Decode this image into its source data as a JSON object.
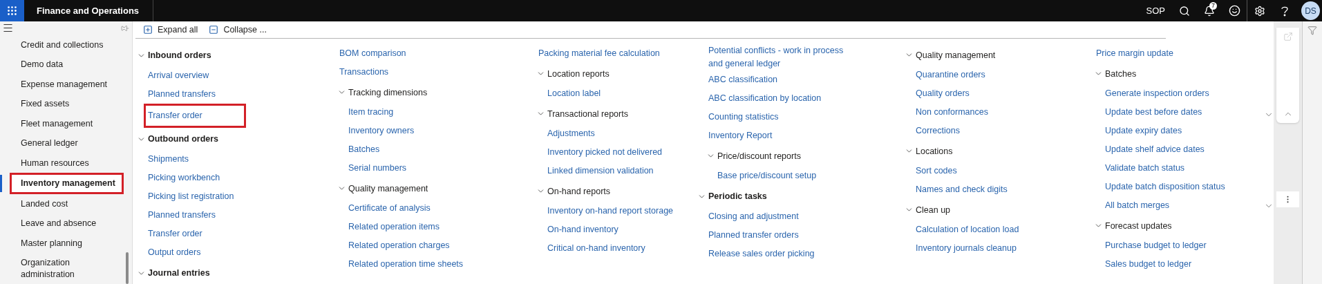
{
  "topbar": {
    "app_title": "Finance and Operations",
    "company": "SOP",
    "notification_count": "7",
    "avatar_initials": "DS"
  },
  "sidebar": {
    "items": [
      {
        "label": "Credit and collections",
        "selected": false,
        "highlighted": false
      },
      {
        "label": "Demo data",
        "selected": false,
        "highlighted": false
      },
      {
        "label": "Expense management",
        "selected": false,
        "highlighted": false
      },
      {
        "label": "Fixed assets",
        "selected": false,
        "highlighted": false
      },
      {
        "label": "Fleet management",
        "selected": false,
        "highlighted": false
      },
      {
        "label": "General ledger",
        "selected": false,
        "highlighted": false
      },
      {
        "label": "Human resources",
        "selected": false,
        "highlighted": false
      },
      {
        "label": "Inventory management",
        "selected": true,
        "highlighted": true
      },
      {
        "label": "Landed cost",
        "selected": false,
        "highlighted": false
      },
      {
        "label": "Leave and absence",
        "selected": false,
        "highlighted": false
      },
      {
        "label": "Master planning",
        "selected": false,
        "highlighted": false
      },
      {
        "label": "Organization administration",
        "selected": false,
        "highlighted": false
      }
    ]
  },
  "toolbar": {
    "expand_all": "Expand all",
    "collapse": "Collapse ..."
  },
  "menu_columns": [
    {
      "entries": [
        {
          "kind": "heading",
          "label": "Inbound orders",
          "expanded": true,
          "children": [
            {
              "kind": "link",
              "label": "Arrival overview",
              "highlighted": false
            },
            {
              "kind": "link",
              "label": "Planned transfers",
              "highlighted": false
            },
            {
              "kind": "link",
              "label": "Transfer order",
              "highlighted": true
            }
          ]
        },
        {
          "kind": "heading",
          "label": "Outbound orders",
          "expanded": true,
          "children": [
            {
              "kind": "link",
              "label": "Shipments",
              "highlighted": false
            },
            {
              "kind": "link",
              "label": "Picking workbench",
              "highlighted": false
            },
            {
              "kind": "link",
              "label": "Picking list registration",
              "highlighted": false
            },
            {
              "kind": "link",
              "label": "Planned transfers",
              "highlighted": false
            },
            {
              "kind": "link",
              "label": "Transfer order",
              "highlighted": false
            },
            {
              "kind": "link",
              "label": "Output orders",
              "highlighted": false
            }
          ]
        },
        {
          "kind": "heading",
          "label": "Journal entries",
          "expanded": true
        }
      ]
    },
    {
      "entries": [
        {
          "kind": "link",
          "label": "BOM comparison",
          "highlighted": false
        },
        {
          "kind": "link",
          "label": "Transactions",
          "highlighted": false
        },
        {
          "kind": "subheading",
          "label": "Tracking dimensions",
          "expanded": true,
          "children": [
            {
              "kind": "link",
              "label": "Item tracing",
              "highlighted": false
            },
            {
              "kind": "link",
              "label": "Inventory owners",
              "highlighted": false
            },
            {
              "kind": "link",
              "label": "Batches",
              "highlighted": false
            },
            {
              "kind": "link",
              "label": "Serial numbers",
              "highlighted": false
            }
          ]
        },
        {
          "kind": "subheading",
          "label": "Quality management",
          "expanded": true,
          "children": [
            {
              "kind": "link",
              "label": "Certificate of analysis",
              "highlighted": false
            },
            {
              "kind": "link",
              "label": "Related operation items",
              "highlighted": false
            },
            {
              "kind": "link",
              "label": "Related operation charges",
              "highlighted": false
            },
            {
              "kind": "link",
              "label": "Related operation time sheets",
              "highlighted": false
            }
          ]
        }
      ]
    },
    {
      "entries": [
        {
          "kind": "link",
          "label": "Packing material fee calculation",
          "highlighted": false
        },
        {
          "kind": "subheading",
          "label": "Location reports",
          "expanded": true,
          "children": [
            {
              "kind": "link",
              "label": "Location label",
              "highlighted": false
            }
          ]
        },
        {
          "kind": "subheading",
          "label": "Transactional reports",
          "expanded": true,
          "children": [
            {
              "kind": "link",
              "label": "Adjustments",
              "highlighted": false
            },
            {
              "kind": "link",
              "label": "Inventory picked not delivered",
              "highlighted": false
            },
            {
              "kind": "link",
              "label": "Linked dimension validation",
              "highlighted": false
            }
          ]
        },
        {
          "kind": "subheading",
          "label": "On-hand reports",
          "expanded": true,
          "children": [
            {
              "kind": "link",
              "label": "Inventory on-hand report storage",
              "highlighted": false
            },
            {
              "kind": "link",
              "label": "On-hand inventory",
              "highlighted": false
            },
            {
              "kind": "link",
              "label": "Critical on-hand inventory",
              "highlighted": false
            }
          ]
        }
      ]
    },
    {
      "entries": [
        {
          "kind": "link",
          "label": "Potential conflicts - work in process and general ledger",
          "highlighted": false
        },
        {
          "kind": "link",
          "label": "ABC classification",
          "highlighted": false
        },
        {
          "kind": "link",
          "label": "ABC classification by location",
          "highlighted": false
        },
        {
          "kind": "link",
          "label": "Counting statistics",
          "highlighted": false
        },
        {
          "kind": "link",
          "label": "Inventory Report",
          "highlighted": false
        },
        {
          "kind": "subheading",
          "label": "Price/discount reports",
          "expanded": true,
          "children": [
            {
              "kind": "link",
              "label": "Base price/discount setup",
              "highlighted": false
            }
          ]
        },
        {
          "kind": "heading",
          "label": "Periodic tasks",
          "expanded": true,
          "children": [
            {
              "kind": "link",
              "label": "Closing and adjustment",
              "highlighted": false
            },
            {
              "kind": "link",
              "label": "Planned transfer orders",
              "highlighted": false
            },
            {
              "kind": "link",
              "label": "Release sales order picking",
              "highlighted": false
            }
          ]
        }
      ]
    },
    {
      "entries": [
        {
          "kind": "subheading",
          "label": "Quality management",
          "expanded": true,
          "children": [
            {
              "kind": "link",
              "label": "Quarantine orders",
              "highlighted": false
            },
            {
              "kind": "link",
              "label": "Quality orders",
              "highlighted": false
            },
            {
              "kind": "link",
              "label": "Non conformances",
              "highlighted": false
            },
            {
              "kind": "link",
              "label": "Corrections",
              "highlighted": false
            }
          ]
        },
        {
          "kind": "subheading",
          "label": "Locations",
          "expanded": true,
          "children": [
            {
              "kind": "link",
              "label": "Sort codes",
              "highlighted": false
            },
            {
              "kind": "link",
              "label": "Names and check digits",
              "highlighted": false
            }
          ]
        },
        {
          "kind": "subheading",
          "label": "Clean up",
          "expanded": true,
          "children": [
            {
              "kind": "link",
              "label": "Calculation of location load",
              "highlighted": false
            },
            {
              "kind": "link",
              "label": "Inventory journals cleanup",
              "highlighted": false
            }
          ]
        }
      ]
    },
    {
      "entries": [
        {
          "kind": "link",
          "label": "Price margin update",
          "highlighted": false
        },
        {
          "kind": "subheading",
          "label": "Batches",
          "expanded": true,
          "children": [
            {
              "kind": "link",
              "label": "Generate inspection orders",
              "highlighted": false
            },
            {
              "kind": "link",
              "label": "Update best before dates",
              "highlighted": false
            },
            {
              "kind": "link",
              "label": "Update expiry dates",
              "highlighted": false
            },
            {
              "kind": "link",
              "label": "Update shelf advice dates",
              "highlighted": false
            },
            {
              "kind": "link",
              "label": "Validate batch status",
              "highlighted": false
            },
            {
              "kind": "link",
              "label": "Update batch disposition status",
              "highlighted": false
            },
            {
              "kind": "link",
              "label": "All batch merges",
              "highlighted": false
            }
          ]
        },
        {
          "kind": "subheading",
          "label": "Forecast updates",
          "expanded": true,
          "children": [
            {
              "kind": "link",
              "label": "Purchase budget to ledger",
              "highlighted": false
            },
            {
              "kind": "link",
              "label": "Sales budget to ledger",
              "highlighted": false
            }
          ]
        }
      ]
    }
  ]
}
